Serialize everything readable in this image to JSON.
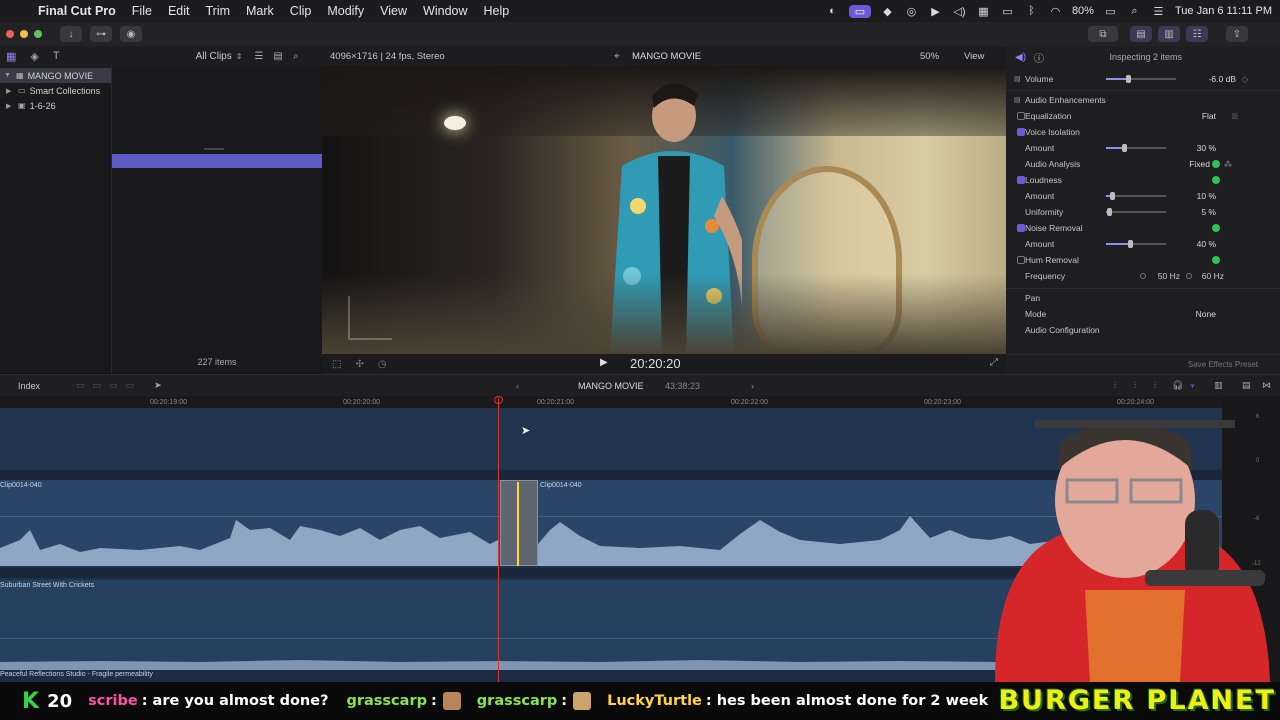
{
  "menubar": {
    "app_name": "Final Cut Pro",
    "menus": [
      "File",
      "Edit",
      "Trim",
      "Mark",
      "Clip",
      "Modify",
      "View",
      "Window",
      "Help"
    ],
    "battery": "80%",
    "datetime": "Tue Jan 6  11:11 PM"
  },
  "browser": {
    "filter": "All Clips",
    "library_name": "MANGO MOVIE",
    "items": [
      "Smart Collections",
      "1-6-26"
    ],
    "item_count": "227 items"
  },
  "viewer": {
    "format": "4096×1716 | 24 fps, Stereo",
    "project": "MANGO MOVIE",
    "zoom": "50%",
    "view_label": "View",
    "timecode": "20:20:20"
  },
  "inspector": {
    "title": "Inspecting 2 items",
    "volume_label": "Volume",
    "volume_value": "-6.0  dB",
    "enhancements_label": "Audio Enhancements",
    "equalization_label": "Equalization",
    "equalization_value": "Flat",
    "voice_isolation_label": "Voice Isolation",
    "amount_label": "Amount",
    "voice_amount": "30  %",
    "voice_amount_level": 0.3,
    "analysis_label": "Audio Analysis",
    "analysis_value": "Fixed",
    "loudness_label": "Loudness",
    "loud_amount": "10  %",
    "loud_amount_level": 0.1,
    "uniformity_label": "Uniformity",
    "uniformity_value": "5  %",
    "uniformity_level": 0.05,
    "noise_label": "Noise Removal",
    "noise_amount": "40  %",
    "noise_amount_level": 0.4,
    "hum_label": "Hum Removal",
    "frequency_label": "Frequency",
    "freq_50": "50 Hz",
    "freq_60": "60 Hz",
    "pan_label": "Pan",
    "mode_label": "Mode",
    "mode_value": "None",
    "config_label": "Audio Configuration",
    "save_preset": "Save Effects Preset"
  },
  "timeline": {
    "index_label": "Index",
    "project": "MANGO MOVIE",
    "duration": "43:38:23",
    "ruler": [
      "00:20:19:00",
      "00:20:20:00",
      "00:20:21:00",
      "00:20:22:00",
      "00:20:23:00",
      "00:20:24:00"
    ],
    "clip_left": "Clip0014-040",
    "clip_right": "Clip0014-040",
    "sfx_clip": "Suburban Street With Crickets",
    "music_clip": "Peaceful Reflections Studio - Fragile permeability",
    "meter_labels": [
      "6",
      "0",
      "-6",
      "-12"
    ]
  },
  "chat": {
    "k_label": "K",
    "k_count": "20",
    "messages": [
      {
        "user": "scribe",
        "text": ": are you almost done?"
      },
      {
        "user": "grasscarp",
        "text": ":"
      },
      {
        "user": "grasscarp",
        "text": ":"
      },
      {
        "user": "LuckyTurtle",
        "text": ": hes been almost done for 2 weeks now"
      }
    ],
    "banner": "BURGER PLANET"
  },
  "colors": {
    "accent": "#6a5ed6",
    "playhead": "#d23a30",
    "timeline_bg": "#213149",
    "chat_green": "#36d24a",
    "banner_yellow": "#f2ee14"
  }
}
